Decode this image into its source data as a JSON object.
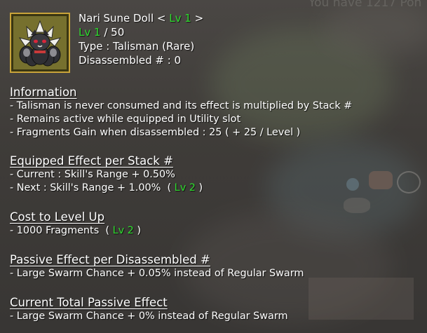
{
  "background_text": "You have 1217 Pon",
  "item": {
    "name": "Nari Sune Doll",
    "level_prefix": "<",
    "level_label": "Lv 1",
    "level_suffix": ">",
    "lv_current": "Lv 1",
    "lv_max": "/ 50",
    "type": "Type : Talisman (Rare)",
    "disassembled": "Disassembled # : 0",
    "icon": "fox-doll-icon"
  },
  "sections": {
    "information": {
      "title": "Information",
      "lines": [
        "- Talisman is never consumed and its effect is multiplied by Stack #",
        "- Remains active while equipped in Utility slot",
        "- Fragments Gain when disassembled : 25 ( + 25 / Level )"
      ]
    },
    "equipped": {
      "title": "Equipped Effect per Stack #",
      "current": "- Current : Skill's Range + 0.50%",
      "next": "- Next : Skill's Range + 1.00%",
      "next_open": "(",
      "next_level": "Lv 2",
      "next_close": ")"
    },
    "cost": {
      "title": "Cost to Level Up",
      "line": "- 1000 Fragments",
      "open": "(",
      "level": "Lv 2",
      "close": ")"
    },
    "passive": {
      "title": "Passive Effect per Disassembled #",
      "line": "- Large Swarm Chance + 0.05% instead of Regular Swarm"
    },
    "total": {
      "title": "Current Total Passive Effect",
      "line": "- Large Swarm Chance + 0% instead of Regular Swarm"
    }
  },
  "colors": {
    "level_green": "#2edb2e",
    "text": "#ffffff",
    "icon_frame": "#c9a43a"
  }
}
